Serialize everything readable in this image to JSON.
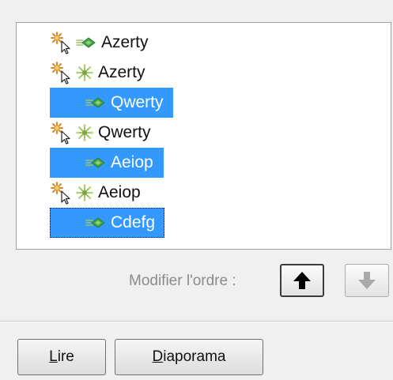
{
  "tree": {
    "items": [
      {
        "label": "Azerty",
        "type": "parent",
        "state": "collapsed",
        "selected": false
      },
      {
        "label": "Azerty",
        "type": "parent",
        "state": "expanded",
        "selected": false
      },
      {
        "label": "Qwerty",
        "type": "child",
        "selected": true
      },
      {
        "label": "Qwerty",
        "type": "parent",
        "state": "expanded",
        "selected": false
      },
      {
        "label": "Aeiop",
        "type": "child",
        "selected": true
      },
      {
        "label": "Aeiop",
        "type": "parent",
        "state": "expanded",
        "selected": false
      },
      {
        "label": "Cdefg",
        "type": "child",
        "selected": true,
        "focused": true
      }
    ],
    "icons": {
      "parent_marker": "star-cursor-icon",
      "expanded": "snowflake-icon",
      "leaf": "arrow-leaf-icon"
    }
  },
  "order": {
    "label": "Modifier l'ordre :",
    "up_icon": "arrow-up-icon",
    "down_icon": "arrow-down-icon",
    "down_enabled": false
  },
  "actions": {
    "lire_mnemonic": "L",
    "lire_rest": "ire",
    "diaporama_mnemonic": "D",
    "diaporama_rest": "iaporama"
  },
  "colors": {
    "selection": "#3399ff",
    "background": "#f0f0f0",
    "list_background": "#ffffff",
    "disabled_text": "#8b8b8b"
  }
}
